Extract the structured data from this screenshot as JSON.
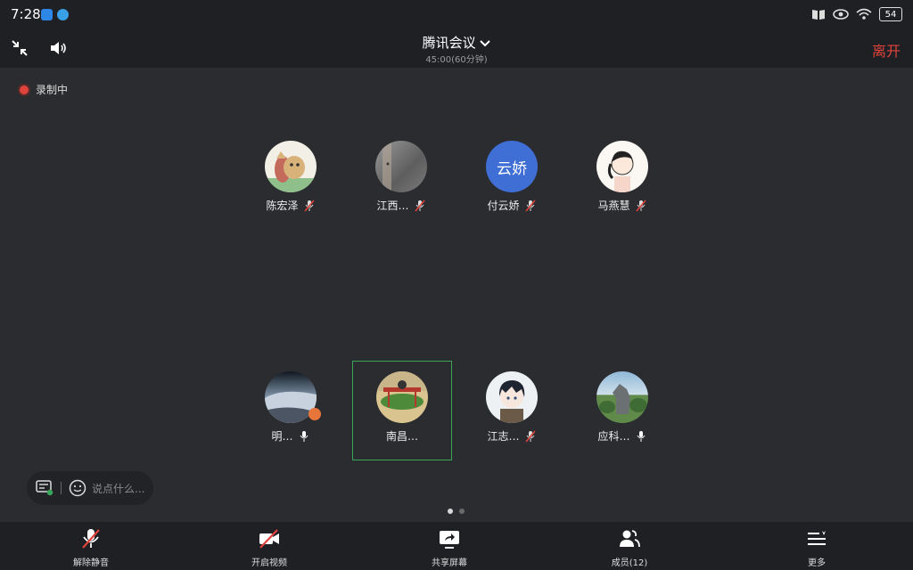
{
  "status_bar": {
    "time": "7:28",
    "battery": "54"
  },
  "header": {
    "title": "腾讯会议",
    "duration": "45:00(60分钟)",
    "leave_label": "离开"
  },
  "recording": {
    "label": "录制中"
  },
  "participants": [
    {
      "name": "陈宏泽",
      "mic": "muted",
      "avatar": "cartoon-squirrel"
    },
    {
      "name": "江西…",
      "mic": "muted",
      "avatar": "gray-photo"
    },
    {
      "name": "付云娇",
      "mic": "muted",
      "avatar_text": "云娇"
    },
    {
      "name": "马燕慧",
      "mic": "muted",
      "avatar": "cartoon-girl"
    },
    {
      "name": "明…",
      "mic": "on",
      "avatar": "sky-photo"
    },
    {
      "name": "南昌…",
      "mic": "none",
      "avatar": "red-scene"
    },
    {
      "name": "江志…",
      "mic": "muted",
      "avatar": "anime-boy"
    },
    {
      "name": "应科…",
      "mic": "on",
      "avatar": "statue-photo"
    }
  ],
  "chat": {
    "placeholder": "说点什么..."
  },
  "toolbar": {
    "unmute": "解除静音",
    "video": "开启视频",
    "share": "共享屏幕",
    "members": "成员(12)",
    "more": "更多"
  },
  "colors": {
    "accent_leave": "#e0433b",
    "speaking_frame": "#3aa65a",
    "avatar_blue": "#3f6fd4"
  }
}
